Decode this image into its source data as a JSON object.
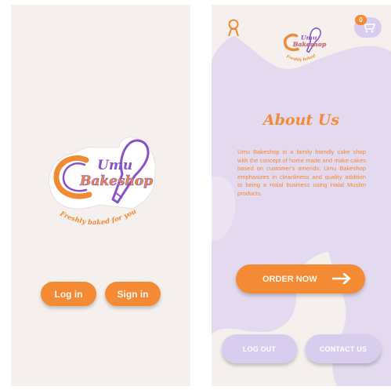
{
  "brand": {
    "name_line1": "Umu",
    "name_line2": "Bakeshop",
    "tagline": "Freshly baked for you"
  },
  "login_screen": {
    "login_label": "Log in",
    "signin_label": "Sign in"
  },
  "about_screen": {
    "title": "About Us",
    "body": "Umu Bakeshop is a family friendly cake shop with the concept of home made and make cakes based on customer's amends. Umu Bakeshop emphasizes in cleanliness and quality addition to being a Halal business using Halal Muslim products.",
    "cart_count": "0",
    "order_label": "ORDER NOW",
    "logout_label": "LOG OUT",
    "contact_label": "CONTACT US"
  },
  "colors": {
    "accent_orange": "#f48a33",
    "accent_purple": "#8a52c9",
    "lilac": "#d9cdef",
    "background": "#f5f0ee"
  },
  "icons": [
    "user-icon",
    "cart-icon",
    "arrow-right-icon",
    "piping-bag-icon"
  ]
}
